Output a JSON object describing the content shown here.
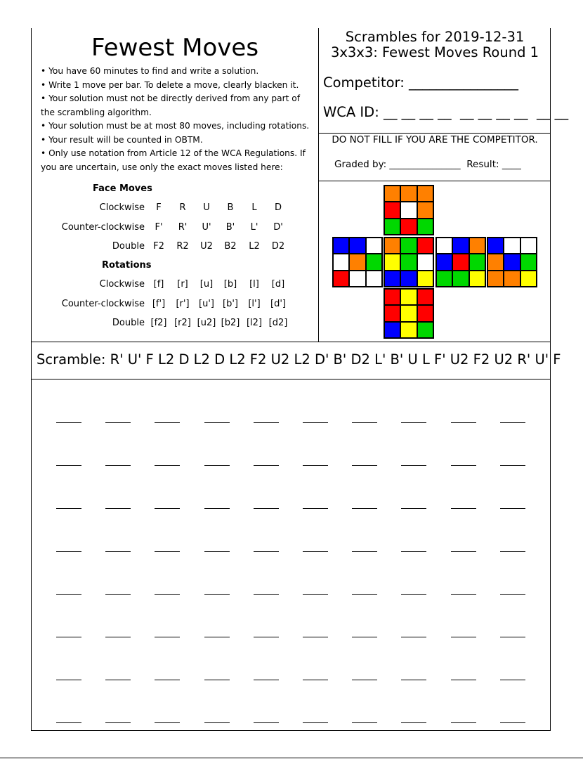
{
  "title": "Fewest Moves",
  "rules": [
    "You have 60 minutes to find and write a solution.",
    "Write 1 move per bar. To delete a move, clearly blacken it.",
    "Your solution must not be directly derived from any part of the scrambling algorithm.",
    "Your solution must be at most 80 moves, including rotations.",
    "Your result will be counted in OBTM.",
    "Only use notation from Article 12 of the WCA Regulations. If you are uncertain, use only the exact moves listed here:"
  ],
  "notation": {
    "face_moves_label": "Face Moves",
    "rotations_label": "Rotations",
    "face_rows": [
      {
        "label": "Clockwise",
        "moves": [
          "F",
          "R",
          "U",
          "B",
          "L",
          "D"
        ]
      },
      {
        "label": "Counter-clockwise",
        "moves": [
          "F'",
          "R'",
          "U'",
          "B'",
          "L'",
          "D'"
        ]
      },
      {
        "label": "Double",
        "moves": [
          "F2",
          "R2",
          "U2",
          "B2",
          "L2",
          "D2"
        ]
      }
    ],
    "rotation_rows": [
      {
        "label": "Clockwise",
        "moves": [
          "[f]",
          "[r]",
          "[u]",
          "[b]",
          "[l]",
          "[d]"
        ]
      },
      {
        "label": "Counter-clockwise",
        "moves": [
          "[f']",
          "[r']",
          "[u']",
          "[b']",
          "[l']",
          "[d']"
        ]
      },
      {
        "label": "Double",
        "moves": [
          "[f2]",
          "[r2]",
          "[u2]",
          "[b2]",
          "[l2]",
          "[d2]"
        ]
      }
    ]
  },
  "header": {
    "line1": "Scrambles for 2019-12-31",
    "line2": "3x3x3: Fewest Moves Round 1",
    "competitor": "Competitor: ________________",
    "wca_id": "WCA ID: __ __ __ __  __ __ __ __  __ __",
    "grading_note": "DO NOT FILL IF YOU ARE THE COMPETITOR.",
    "graded_by": "Graded by: _______________  Result: ____"
  },
  "scramble": "Scramble: R' U' F L2 D L2 D L2 F2 U2 L2 D' B' D2 L' B' U L F' U2 F2 U2 R' U' F",
  "colors": {
    "W": "#ffffff",
    "Y": "#ffff00",
    "R": "#ff0000",
    "O": "#ff8000",
    "G": "#00d800",
    "B": "#0000ff"
  },
  "cube": {
    "U": [
      "O",
      "O",
      "O",
      "R",
      "W",
      "O",
      "G",
      "R",
      "G"
    ],
    "L": [
      "B",
      "B",
      "W",
      "W",
      "O",
      "G",
      "R",
      "W",
      "W"
    ],
    "F": [
      "O",
      "G",
      "R",
      "Y",
      "G",
      "W",
      "B",
      "B",
      "Y"
    ],
    "R": [
      "W",
      "B",
      "O",
      "B",
      "R",
      "G",
      "G",
      "G",
      "Y"
    ],
    "B": [
      "B",
      "W",
      "W",
      "O",
      "B",
      "G",
      "O",
      "O",
      "Y"
    ],
    "D": [
      "R",
      "Y",
      "R",
      "R",
      "Y",
      "R",
      "B",
      "Y",
      "G"
    ]
  },
  "answer_grid": {
    "rows": 8,
    "cols": 10
  }
}
